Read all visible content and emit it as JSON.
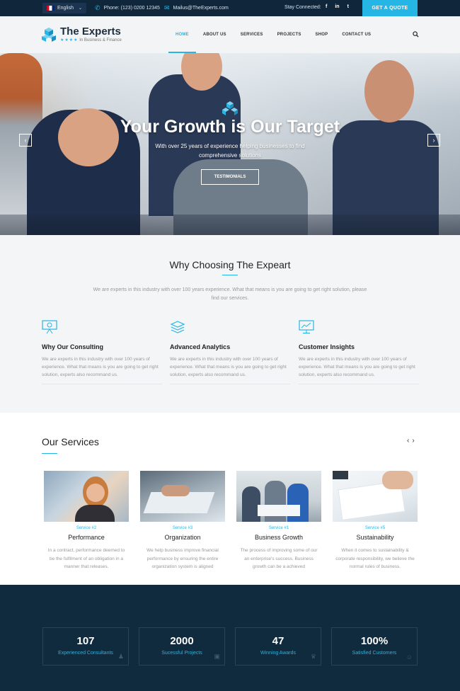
{
  "topbar": {
    "language": "English",
    "phone": "Phone: (123) 0200 12345",
    "email": "Mailus@TheExperts.com",
    "stay_connected": "Stay Connected:",
    "social": [
      "f",
      "in",
      "t"
    ],
    "quote_button": "GET A QUOTE"
  },
  "header": {
    "logo_title": "The Experts",
    "logo_stars": "★★★★",
    "logo_subtitle": "In Business & Finance",
    "nav": [
      "HOME",
      "ABOUT US",
      "SERVICES",
      "PROJECTS",
      "SHOP",
      "CONTACT US"
    ],
    "active_nav": "HOME"
  },
  "hero": {
    "title": "Your Growth is Our Target",
    "subtitle": "With over 25 years of experience helping businesses to find comprehensive solutions",
    "button": "TESTIMONIALS",
    "prev_arrow": "‹",
    "next_arrow": "›"
  },
  "why": {
    "title": "Why Choosing The Expeart",
    "intro": "We are experts in this industry with over 100 years experience. What that means is you are going to get right solution, please find our services.",
    "features": [
      {
        "title": "Why Our Consulting",
        "text": "We are experts in this industry with over 100 years of experience. What that means is you are going to get right solution, experts also recommand us."
      },
      {
        "title": "Advanced Analytics",
        "text": "We are experts in this industry with over 100 years of experience. What that means is you are going to get right solution, experts also recommand us."
      },
      {
        "title": "Customer Insights",
        "text": "We are experts in this industry with over 100 years of experience. What that means is you are going to get right solution, experts also recommand us."
      }
    ]
  },
  "services": {
    "title": "Our Services",
    "prev": "‹",
    "next": "›",
    "cards": [
      {
        "tag": "Service #2",
        "title": "Performance",
        "text": "In a contract, performance deemed to be the fulfilment of an obligation in a manner that releases."
      },
      {
        "tag": "Service #3",
        "title": "Organization",
        "text": "We help business improve financial performance by ensuring the entire organization system is aligned"
      },
      {
        "tag": "Service #1",
        "title": "Business Growth",
        "text": "The process of improving some of our an enterprise's success. Business growth can be a achieved"
      },
      {
        "tag": "Service #5",
        "title": "Sustainability",
        "text": "When it comes to sustainability & corporate responsibility, we believe the normal rules of business."
      }
    ]
  },
  "stats": [
    {
      "value": "107",
      "label": "Experienced Consultants"
    },
    {
      "value": "2000",
      "label": "Sucessful Projects"
    },
    {
      "value": "47",
      "label": "Winning Awards"
    },
    {
      "value": "100%",
      "label": "Satisfied Customers"
    }
  ],
  "colors": {
    "accent": "#26b6e6",
    "topbar_bg": "#10263a",
    "stats_bg": "#0f2b3d"
  }
}
